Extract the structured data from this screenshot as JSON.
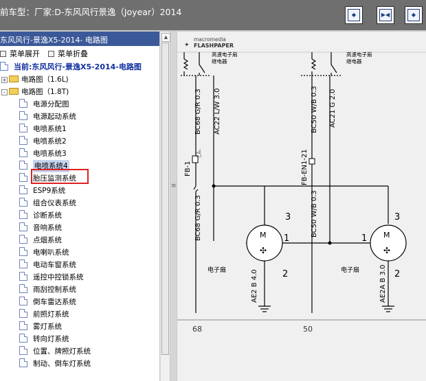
{
  "window": {
    "title": "前车型：厂家:D-东风风行景逸（Joyear）2014"
  },
  "toolbar_buttons": [
    {
      "name": "fit-width-button",
      "glyph": "◆"
    },
    {
      "name": "fit-page-button",
      "glyph": "▶◀"
    },
    {
      "name": "next-page-button",
      "glyph": "◆"
    }
  ],
  "left_pane": {
    "header": "东风风行-景逸X5-2014- 电路图",
    "expand_label": "菜单展开",
    "collapse_label": "菜单折叠"
  },
  "tree": {
    "root": "当前:东风风行-景逸X5-2014-电路图",
    "folders": [
      {
        "label": "电路图（1.6L)",
        "state": "+"
      },
      {
        "label": "电路图（1.8T)",
        "state": "-"
      }
    ],
    "items": [
      "电源分配图",
      "电源起动系统",
      "电喷系统1",
      "电喷系统2",
      "电喷系统3",
      "电喷系统4",
      "胎压监测系统",
      "ESP9系统",
      "组合仪表系统",
      "诊断系统",
      "音响系统",
      "点烟系统",
      "电喇叭系统",
      "电动车窗系统",
      "遥控中控锁系统",
      "雨刮控制系统",
      "倒车雷达系统",
      "前照灯系统",
      "雾灯系统",
      "转向灯系统",
      "位置、牌照灯系统",
      "制动、倒车灯系统"
    ],
    "selected": "电喷系统4"
  },
  "viewer": {
    "logo_line1": "macromedia",
    "logo_line2": "FLASHPAPER",
    "relay_label_left": "高速电子扇\n继电器",
    "relay_label_right": "高速电子扇\n继电器",
    "wires": {
      "bc68_top": "BC68 G/R 0.3",
      "ac22": "AC22 L/W 3.0",
      "bc50_top": "BC50 W/B 0.3",
      "ac21": "AC21 G 2.0",
      "fb1": "FB-1",
      "fb_en1_21": "FB-EN1-21",
      "bc68_bot": "BC68 G/R 0.3",
      "bc50_bot": "BC50 W/B 0.3",
      "ae2_left": "AE2 B 4.0",
      "ae2a_right": "AE2A B 3.0"
    },
    "fan_label_left": "电子扇",
    "fan_label_right": "电子扇",
    "pins": {
      "left_3": "3",
      "left_1": "1",
      "left_2": "2",
      "right_3": "3",
      "right_1": "1",
      "right_2": "2"
    },
    "motor_letter": "M",
    "page_refs": [
      "68",
      "50"
    ]
  }
}
